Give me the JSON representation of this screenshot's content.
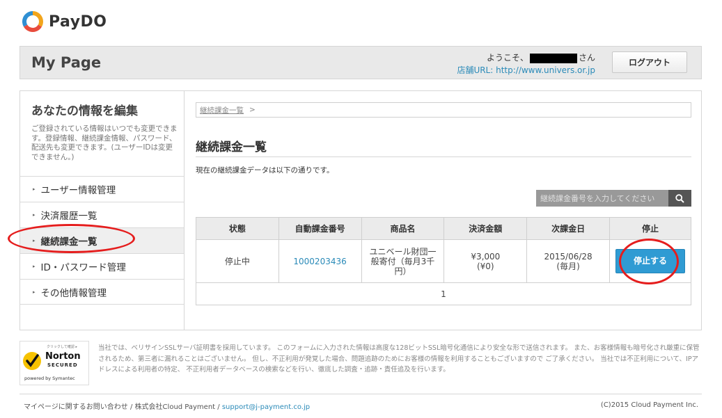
{
  "brand": {
    "name": "PayDO"
  },
  "header": {
    "title": "My Page",
    "welcome_prefix": "ようこそ、",
    "welcome_suffix": "さん",
    "shop_url": "店舗URL: http://www.univers.or.jp",
    "logout_label": "ログアウト"
  },
  "sidebar": {
    "title": "あなたの情報を編集",
    "description": "ご登録されている情報はいつでも変更できます。登録情報、継続課金情報、パスワード、配送先も変更できます。(ユーザーIDは変更できません。)",
    "items": [
      {
        "label": "ユーザー情報管理"
      },
      {
        "label": "決済履歴一覧"
      },
      {
        "label": "継続課金一覧"
      },
      {
        "label": "ID・パスワード管理"
      },
      {
        "label": "その他情報管理"
      }
    ]
  },
  "breadcrumb": {
    "item": "継続課金一覧",
    "separator": ">"
  },
  "main": {
    "title": "継続課金一覧",
    "description": "現在の継続課金データは以下の通りです。",
    "search_placeholder": "継続課金番号を入力してください"
  },
  "table": {
    "headers": [
      "状態",
      "自動課金番号",
      "商品名",
      "決済金額",
      "次課金日",
      "停止"
    ],
    "row": {
      "status": "停止中",
      "number": "1000203436",
      "product": "ユニベール財団一般寄付（毎月3千円）",
      "amount": "¥3,000",
      "amount_sub": "(¥0)",
      "next_date": "2015/06/28",
      "next_period": "(毎月)",
      "stop_label": "停止する"
    },
    "page": "1"
  },
  "footer": {
    "norton_small": "クリックして確認 ▸",
    "norton_name": "Norton",
    "norton_secured": "SECURED",
    "norton_powered": "powered by Symantec",
    "notice": "当社では、ベリサインSSLサーバ証明書を採用しています。 このフォームに入力された情報は高度な128ビットSSL暗号化通信により安全な形で送信されます。 また、お客様情報も暗号化され厳重に保管されるため、第三者に漏れることはございません。 但し、不正利用が発覚した場合、問題追跡のためにお客様の情報を利用することもございますので ご了承ください。 当社では不正利用について、IPアドレスによる利用者の特定、 不正利用者データベースの検索などを行い、徹底した調査・追跡・責任追及を行います。",
    "contact_label": "マイページに関するお問い合わせ",
    "company": "株式会社Cloud Payment",
    "email": "support@j-payment.co.jp",
    "copyright": "(C)2015 Cloud Payment Inc."
  },
  "colors": {
    "accent": "#2f9bd3",
    "link": "#2a8ab8",
    "annotation": "#e51d1d"
  }
}
